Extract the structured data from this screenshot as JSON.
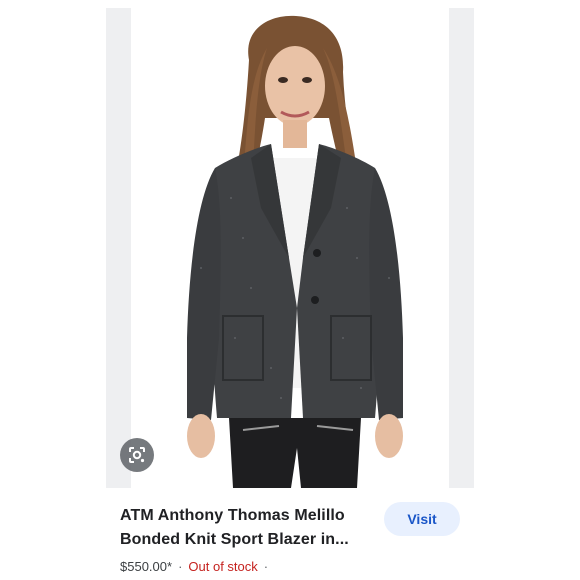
{
  "product": {
    "title": "ATM Anthony Thomas Melillo Bonded Knit Sport Blazer in...",
    "price": "$550.00*",
    "stock_status": "Out of stock",
    "separator": "·",
    "trailing_separator": "·"
  },
  "actions": {
    "visit_label": "Visit",
    "lens_icon": "google-lens-icon"
  },
  "colors": {
    "visit_bg": "#e8f0fe",
    "visit_text": "#1a56c8",
    "out_of_stock": "#c5221f",
    "blazer": "#3f4144"
  }
}
